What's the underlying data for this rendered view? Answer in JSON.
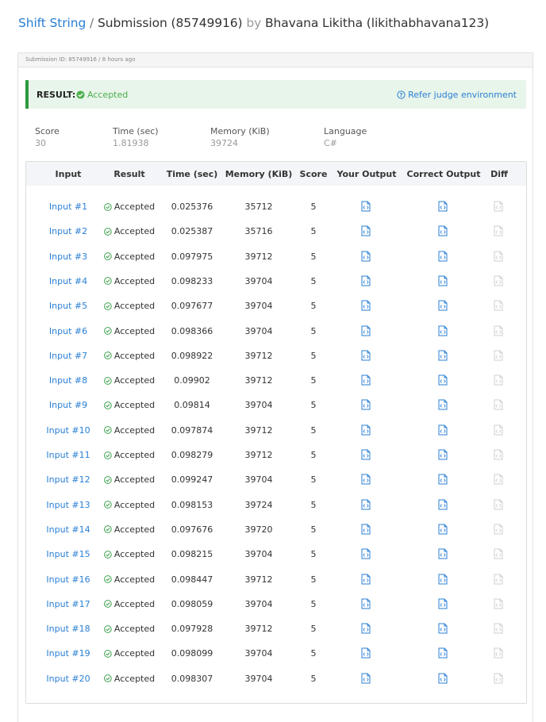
{
  "header": {
    "problem": "Shift String",
    "separator": "/",
    "submission": "Submission (85749916)",
    "by": "by",
    "author": "Bhavana Likitha (likithabhavana123)"
  },
  "panel": {
    "meta": "Submission ID: 85749916 / 8 hours ago"
  },
  "result": {
    "label": "RESULT:",
    "status": "Accepted",
    "refer": "Refer judge environment"
  },
  "stats": [
    {
      "label": "Score",
      "value": "30"
    },
    {
      "label": "Time (sec)",
      "value": "1.81938"
    },
    {
      "label": "Memory (KiB)",
      "value": "39724"
    },
    {
      "label": "Language",
      "value": "C#"
    }
  ],
  "table": {
    "headers": [
      "Input",
      "Result",
      "Time (sec)",
      "Memory (KiB)",
      "Score",
      "Your Output",
      "Correct Output",
      "Diff"
    ],
    "rows": [
      {
        "input": "Input #1",
        "result": "Accepted",
        "time": "0.025376",
        "memory": "35712",
        "score": "5"
      },
      {
        "input": "Input #2",
        "result": "Accepted",
        "time": "0.025387",
        "memory": "35716",
        "score": "5"
      },
      {
        "input": "Input #3",
        "result": "Accepted",
        "time": "0.097975",
        "memory": "39712",
        "score": "5"
      },
      {
        "input": "Input #4",
        "result": "Accepted",
        "time": "0.098233",
        "memory": "39704",
        "score": "5"
      },
      {
        "input": "Input #5",
        "result": "Accepted",
        "time": "0.097677",
        "memory": "39704",
        "score": "5"
      },
      {
        "input": "Input #6",
        "result": "Accepted",
        "time": "0.098366",
        "memory": "39704",
        "score": "5"
      },
      {
        "input": "Input #7",
        "result": "Accepted",
        "time": "0.098922",
        "memory": "39712",
        "score": "5"
      },
      {
        "input": "Input #8",
        "result": "Accepted",
        "time": "0.09902",
        "memory": "39712",
        "score": "5"
      },
      {
        "input": "Input #9",
        "result": "Accepted",
        "time": "0.09814",
        "memory": "39704",
        "score": "5"
      },
      {
        "input": "Input #10",
        "result": "Accepted",
        "time": "0.097874",
        "memory": "39712",
        "score": "5"
      },
      {
        "input": "Input #11",
        "result": "Accepted",
        "time": "0.098279",
        "memory": "39712",
        "score": "5"
      },
      {
        "input": "Input #12",
        "result": "Accepted",
        "time": "0.099247",
        "memory": "39704",
        "score": "5"
      },
      {
        "input": "Input #13",
        "result": "Accepted",
        "time": "0.098153",
        "memory": "39724",
        "score": "5"
      },
      {
        "input": "Input #14",
        "result": "Accepted",
        "time": "0.097676",
        "memory": "39720",
        "score": "5"
      },
      {
        "input": "Input #15",
        "result": "Accepted",
        "time": "0.098215",
        "memory": "39704",
        "score": "5"
      },
      {
        "input": "Input #16",
        "result": "Accepted",
        "time": "0.098447",
        "memory": "39712",
        "score": "5"
      },
      {
        "input": "Input #17",
        "result": "Accepted",
        "time": "0.098059",
        "memory": "39704",
        "score": "5"
      },
      {
        "input": "Input #18",
        "result": "Accepted",
        "time": "0.097928",
        "memory": "39712",
        "score": "5"
      },
      {
        "input": "Input #19",
        "result": "Accepted",
        "time": "0.098099",
        "memory": "39704",
        "score": "5"
      },
      {
        "input": "Input #20",
        "result": "Accepted",
        "time": "0.098307",
        "memory": "39704",
        "score": "5"
      }
    ]
  },
  "icons": {
    "check": "check-circle-icon",
    "question": "question-circle-icon",
    "file": "code-file-icon"
  },
  "colors": {
    "link": "#2a7fd4",
    "accepted": "#4cae4c",
    "result_bar_bg": "#e8f5ea",
    "result_bar_border": "#2e9a3e",
    "diff_disabled": "#cfcfcf"
  }
}
